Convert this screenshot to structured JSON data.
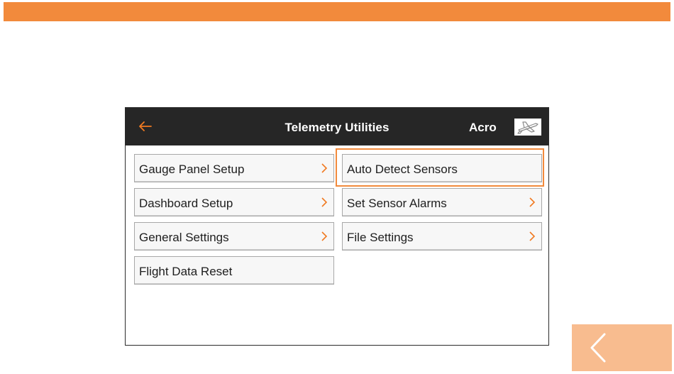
{
  "window": {
    "title": "Telemetry Utilities",
    "model_name": "Acro",
    "model_icon": "airplane-icon",
    "back_icon": "back-arrow-icon"
  },
  "menu": {
    "left": [
      {
        "label": "Gauge Panel Setup",
        "has_chevron": true
      },
      {
        "label": "Dashboard Setup",
        "has_chevron": true
      },
      {
        "label": "General Settings",
        "has_chevron": true
      },
      {
        "label": "Flight Data Reset",
        "has_chevron": false
      }
    ],
    "right": [
      {
        "label": "Auto Detect Sensors",
        "has_chevron": false,
        "highlighted": true
      },
      {
        "label": "Set Sensor Alarms",
        "has_chevron": true
      },
      {
        "label": "File Settings",
        "has_chevron": true
      }
    ]
  },
  "colors": {
    "accent": "#f28a3c",
    "titlebar": "#262626",
    "nav_button": "#f8bc8f"
  },
  "nav": {
    "back_icon": "chevron-left-icon"
  }
}
